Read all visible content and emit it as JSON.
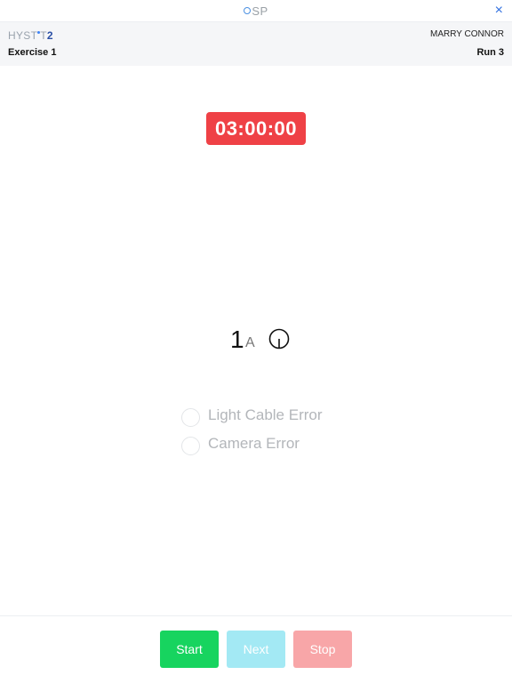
{
  "topbar": {
    "logo_text": "SP",
    "close_glyph": "×"
  },
  "header": {
    "brand_prefix": "HYST",
    "brand_mid": "T",
    "brand_suffix": "2",
    "user_name": "MARRY CONNOR",
    "exercise_label": "Exercise 1",
    "run_label": "Run 3"
  },
  "timer": {
    "value": "03:00:00",
    "color": "#ef4146"
  },
  "position": {
    "number": "1",
    "letter": "A",
    "icon": "clock-icon"
  },
  "errors": [
    {
      "label": "Light Cable Error",
      "checked": false
    },
    {
      "label": "Camera Error",
      "checked": false
    }
  ],
  "buttons": {
    "start": "Start",
    "next": "Next",
    "stop": "Stop"
  },
  "colors": {
    "start": "#17d45f",
    "next": "#a3e9f4",
    "stop": "#f8a6a8"
  }
}
